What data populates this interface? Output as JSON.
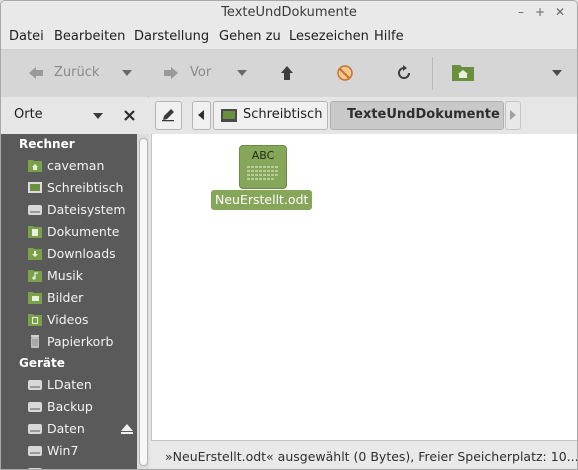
{
  "window": {
    "title": "TexteUndDokumente"
  },
  "menu": [
    "Datei",
    "Bearbeiten",
    "Darstellung",
    "Gehen zu",
    "Lesezeichen",
    "Hilfe"
  ],
  "toolbar": {
    "back_label": "Zurück",
    "forward_label": "Vor"
  },
  "sidebar": {
    "header": "Orte",
    "section_computer": "Rechner",
    "computer_items": [
      "caveman",
      "Schreibtisch",
      "Dateisystem",
      "Dokumente",
      "Downloads",
      "Musik",
      "Bilder",
      "Videos",
      "Papierkorb"
    ],
    "section_devices": "Geräte",
    "device_items": [
      "LDaten",
      "Backup",
      "Daten",
      "Win7"
    ]
  },
  "pathbar": {
    "crumbs": [
      "Schreibtisch",
      "TexteUndDokumente"
    ]
  },
  "file": {
    "name": "NeuErstellt.odt",
    "thumb_text": "ABC"
  },
  "status": {
    "text": "»NeuErstellt.odt« ausgewählt (0 Bytes), Freier Speicherplatz: 10..."
  },
  "colors": {
    "sidebar_bg": "#5a5a5a",
    "accent_green": "#86a65a"
  }
}
